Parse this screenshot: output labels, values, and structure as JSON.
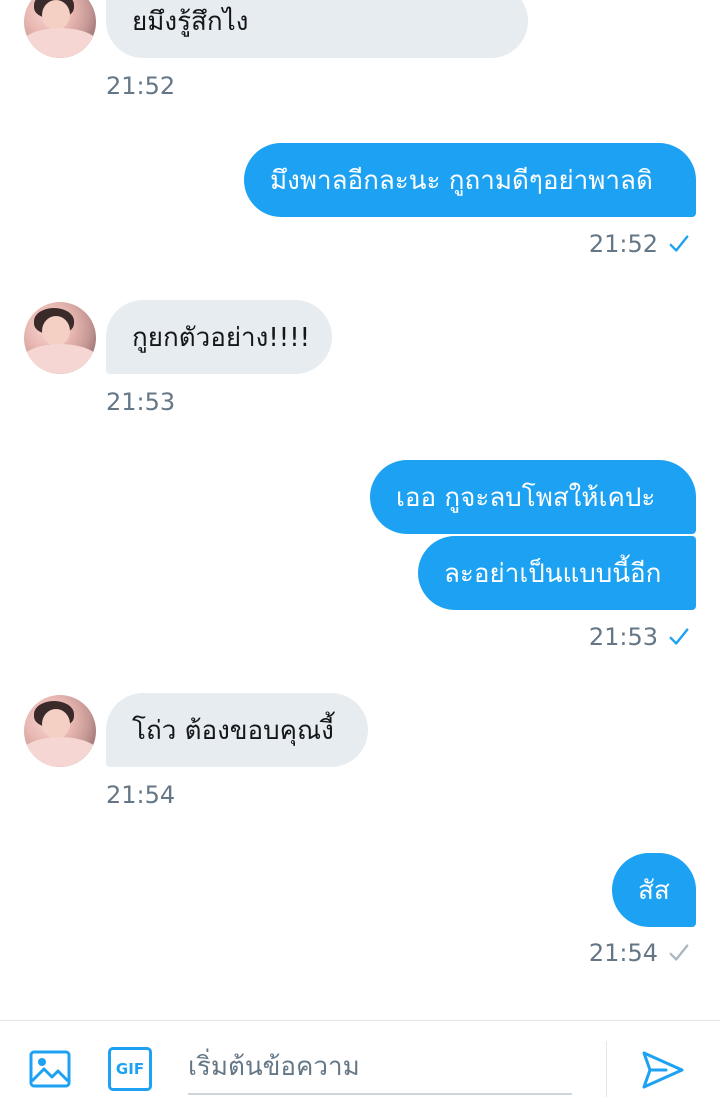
{
  "messages": [
    {
      "direction": "in",
      "text": "ยมึงรู้สึกไง",
      "time": "21:52"
    },
    {
      "direction": "out",
      "text": "มึงพาลอีกละนะ กูถามดีๆอย่าพาลดิ",
      "time": "21:52"
    },
    {
      "direction": "in",
      "text": "กูยกตัวอย่าง!!!!",
      "time": "21:53"
    },
    {
      "direction": "out",
      "text": "เออ กูจะลบโพสให้เคปะ"
    },
    {
      "direction": "out",
      "text": "ละอย่าเป็นแบบนี้อีก",
      "time": "21:53"
    },
    {
      "direction": "in",
      "text": "โถ่ว ต้องขอบคุณงี้",
      "time": "21:54"
    },
    {
      "direction": "out",
      "text": "สัส",
      "time": "21:54"
    }
  ],
  "composer": {
    "placeholder": "เริ่มต้นข้อความ",
    "image_icon": "image-icon",
    "gif_icon": "gif-icon",
    "gif_label": "GIF",
    "send_icon": "send-icon"
  },
  "colors": {
    "accent": "#1da1f2",
    "incoming_bubble": "#e6ecf0",
    "timestamp": "#657786",
    "read_check": "#1da1f2",
    "sent_check": "#aab8c2"
  }
}
